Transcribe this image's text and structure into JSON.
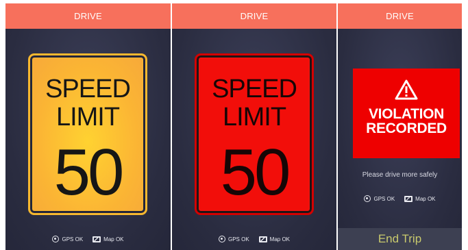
{
  "screens": [
    {
      "header": "DRIVE",
      "sign": {
        "line1": "SPEED",
        "line2": "LIMIT",
        "number": "50",
        "state": "normal",
        "color": "#fbb534"
      },
      "status": {
        "gps": "GPS OK",
        "map": "Map OK"
      }
    },
    {
      "header": "DRIVE",
      "sign": {
        "line1": "SPEED",
        "line2": "LIMIT",
        "number": "50",
        "state": "exceeded",
        "color": "#f20e0a"
      },
      "status": {
        "gps": "GPS OK",
        "map": "Map OK"
      }
    },
    {
      "header": "DRIVE",
      "violation": {
        "line1": "VIOLATION",
        "line2": "RECORDED",
        "icon": "warning-icon",
        "color": "#ee0000"
      },
      "message": "Please drive more safely",
      "status": {
        "gps": "GPS OK",
        "map": "Map OK"
      },
      "end_trip_label": "End Trip"
    }
  ],
  "colors": {
    "header": "#f7705c",
    "background": "#2a2c40",
    "end_trip_text": "#c9ca6d"
  }
}
